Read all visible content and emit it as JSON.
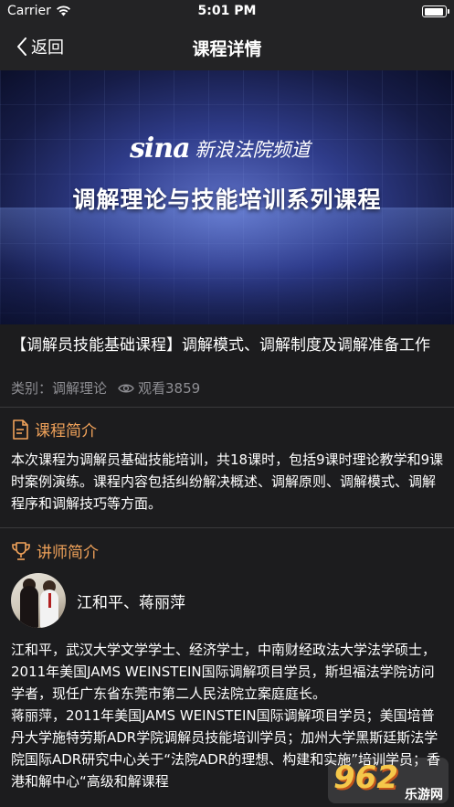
{
  "status_bar": {
    "carrier": "Carrier",
    "time": "5:01 PM",
    "battery_level": 0.95
  },
  "nav": {
    "back_label": "返回",
    "title": "课程详情"
  },
  "video": {
    "logo_mark": "sina",
    "logo_text": "新浪法院频道",
    "title": "调解理论与技能培训系列课程"
  },
  "course": {
    "title": "【调解员技能基础课程】调解模式、调解制度及调解准备工作",
    "category": "类别：调解理论",
    "views": "观看3859"
  },
  "intro": {
    "heading": "课程简介",
    "text": "本次课程为调解员基础技能培训，共18课时，包括9课时理论教学和9课时案例演练。课程内容包括纠纷解决概述、调解原则、调解模式、调解程序和调解技巧等方面。"
  },
  "teacher": {
    "heading": "讲师简介",
    "names": "江和平、蒋丽萍",
    "bio_1": "江和平，武汉大学文学学士、经济学士，中南财经政法大学法学硕士，2011年美国JAMS WEINSTEIN国际调解项目学员，斯坦福法学院访问学者，现任广东省东莞市第二人民法院立案庭庭长。",
    "bio_2": "蒋丽萍，2011年美国JAMS WEINSTEIN国际调解项目学员；美国培普丹大学施特劳斯ADR学院调解员技能培训学员；加州大学黑斯廷斯法学院国际ADR研究中心关于“法院ADR的理想、构建和实施”培训学员；香港和解中心“高级和解课程"
  },
  "watermark": {
    "number": "962",
    "text": "乐游网"
  },
  "colors": {
    "background": "#1c1c1e",
    "bar": "#232325",
    "accent": "#f0a25a",
    "secondary_text": "#8e8e93"
  }
}
